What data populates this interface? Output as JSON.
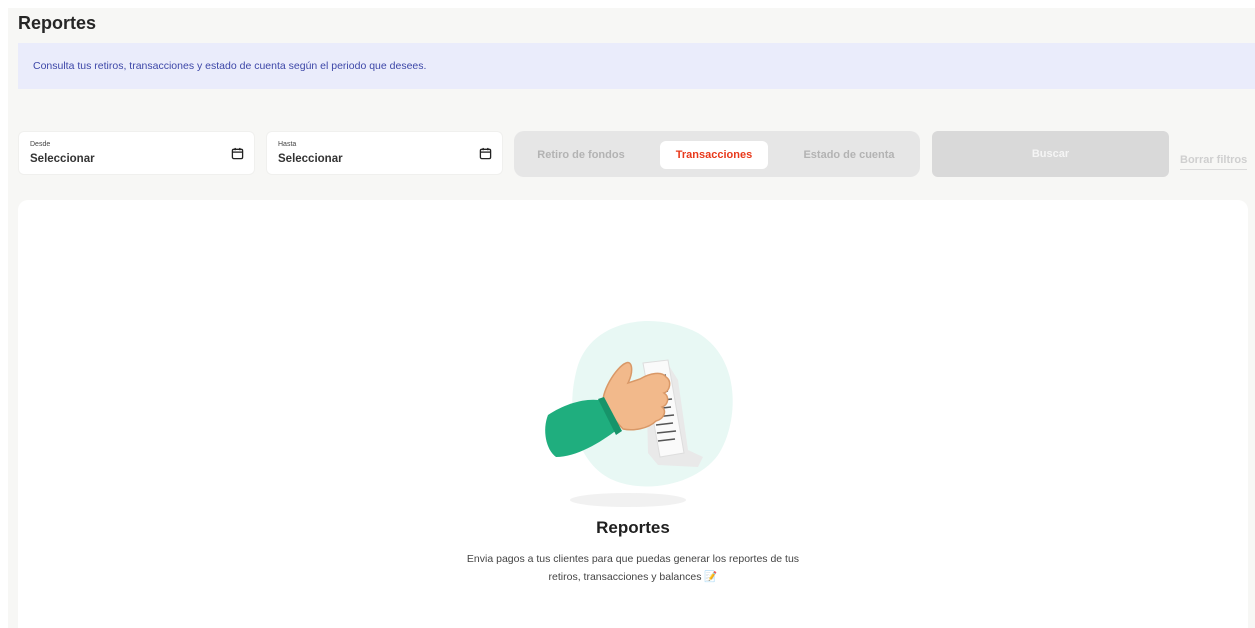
{
  "header": {
    "title": "Reportes"
  },
  "info_banner": {
    "text": "Consulta tus retiros, transacciones y estado de cuenta según el periodo que desees."
  },
  "filters": {
    "from": {
      "label": "Desde",
      "value": "Seleccionar",
      "icon": "calendar-icon"
    },
    "to": {
      "label": "Hasta",
      "value": "Seleccionar",
      "icon": "calendar-icon"
    },
    "report_types": [
      {
        "label": "Retiro de fondos",
        "active": false
      },
      {
        "label": "Transacciones",
        "active": true
      },
      {
        "label": "Estado de cuenta",
        "active": false
      }
    ],
    "search_label": "Buscar",
    "clear_label": "Borrar filtros"
  },
  "empty_state": {
    "illustration": "hand-holding-receipt-illustration",
    "title": "Reportes",
    "line1": "Envia pagos a tus clientes para que puedas generar los reportes de tus",
    "line2": "retiros, transacciones y balances",
    "emoji": "📝"
  },
  "colors": {
    "accent": "#e8391b",
    "banner_bg": "#eaecfb",
    "banner_text": "#3d47a8",
    "sleeve": "#1fae7e",
    "blob": "#e8f8f4"
  }
}
